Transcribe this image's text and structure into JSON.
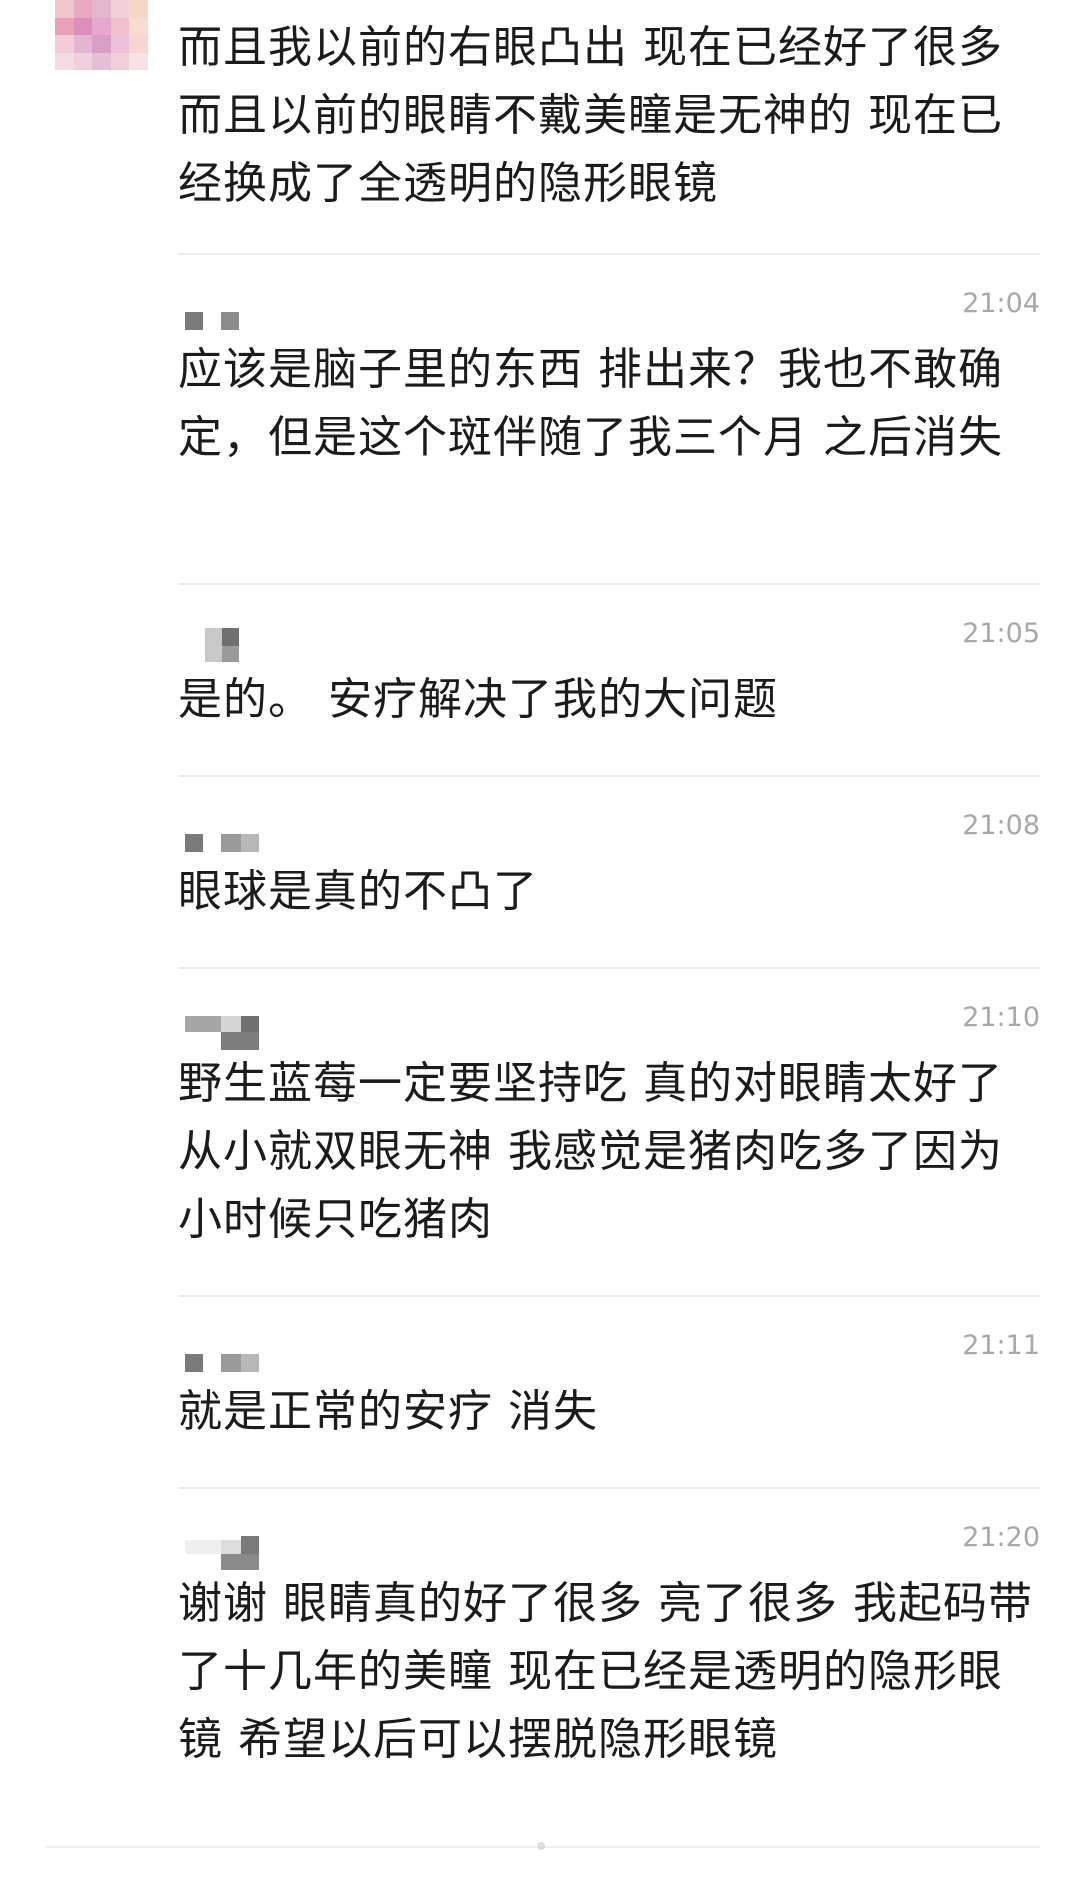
{
  "comments": [
    {
      "id": "c1",
      "user": "user-pixelated-avatar",
      "text": "而且我以前的右眼凸出 现在已经好了很多 而且以前的眼睛不戴美瞳是无神的 现在已经换成了全透明的隐形眼镜"
    },
    {
      "id": "c2",
      "time": "21:04",
      "text": "应该是脑子里的东西 排出来？我也不敢确定，但是这个斑伴随了我三个月 之后消失"
    },
    {
      "id": "c3",
      "time": "21:05",
      "text": "是的。 安疗解决了我的大问题"
    },
    {
      "id": "c4",
      "time": "21:08",
      "text": "眼球是真的不凸了"
    },
    {
      "id": "c5",
      "time": "21:10",
      "text": "野生蓝莓一定要坚持吃 真的对眼睛太好了 从小就双眼无神 我感觉是猪肉吃多了因为小时候只吃猪肉"
    },
    {
      "id": "c6",
      "time": "21:11",
      "text": "就是正常的安疗 消失"
    },
    {
      "id": "c7",
      "time": "21:20",
      "text": "谢谢 眼睛真的好了很多 亮了很多 我起码带了十几年的美瞳 现在已经是透明的隐形眼镜 希望以后可以摆脱隐形眼镜"
    }
  ],
  "colors": {
    "text": "#1b1b1b",
    "time": "#a8a8a8",
    "divider": "#ececec",
    "name_blur_dark": "#7a7a7a",
    "name_blur_light": "#c4c4c4"
  }
}
